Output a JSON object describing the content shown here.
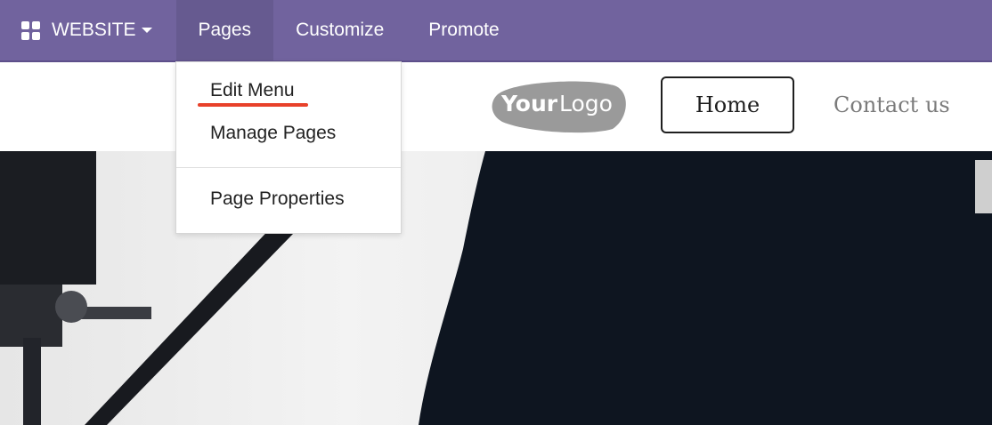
{
  "topbar": {
    "app_name": "WEBSITE",
    "menus": [
      "Pages",
      "Customize",
      "Promote"
    ],
    "active_menu": "Pages",
    "background": "#71639e"
  },
  "site_header": {
    "logo": {
      "text_bold": "Your",
      "text_light": "Logo"
    },
    "nav": [
      {
        "label": "Home",
        "active": true
      },
      {
        "label": "Contact us",
        "active": false
      }
    ]
  },
  "pages_dropdown": {
    "items": [
      "Edit Menu",
      "Manage Pages"
    ],
    "footer_items": [
      "Page Properties"
    ],
    "highlighted_item": "Edit Menu",
    "highlight_color": "#e8412a"
  }
}
